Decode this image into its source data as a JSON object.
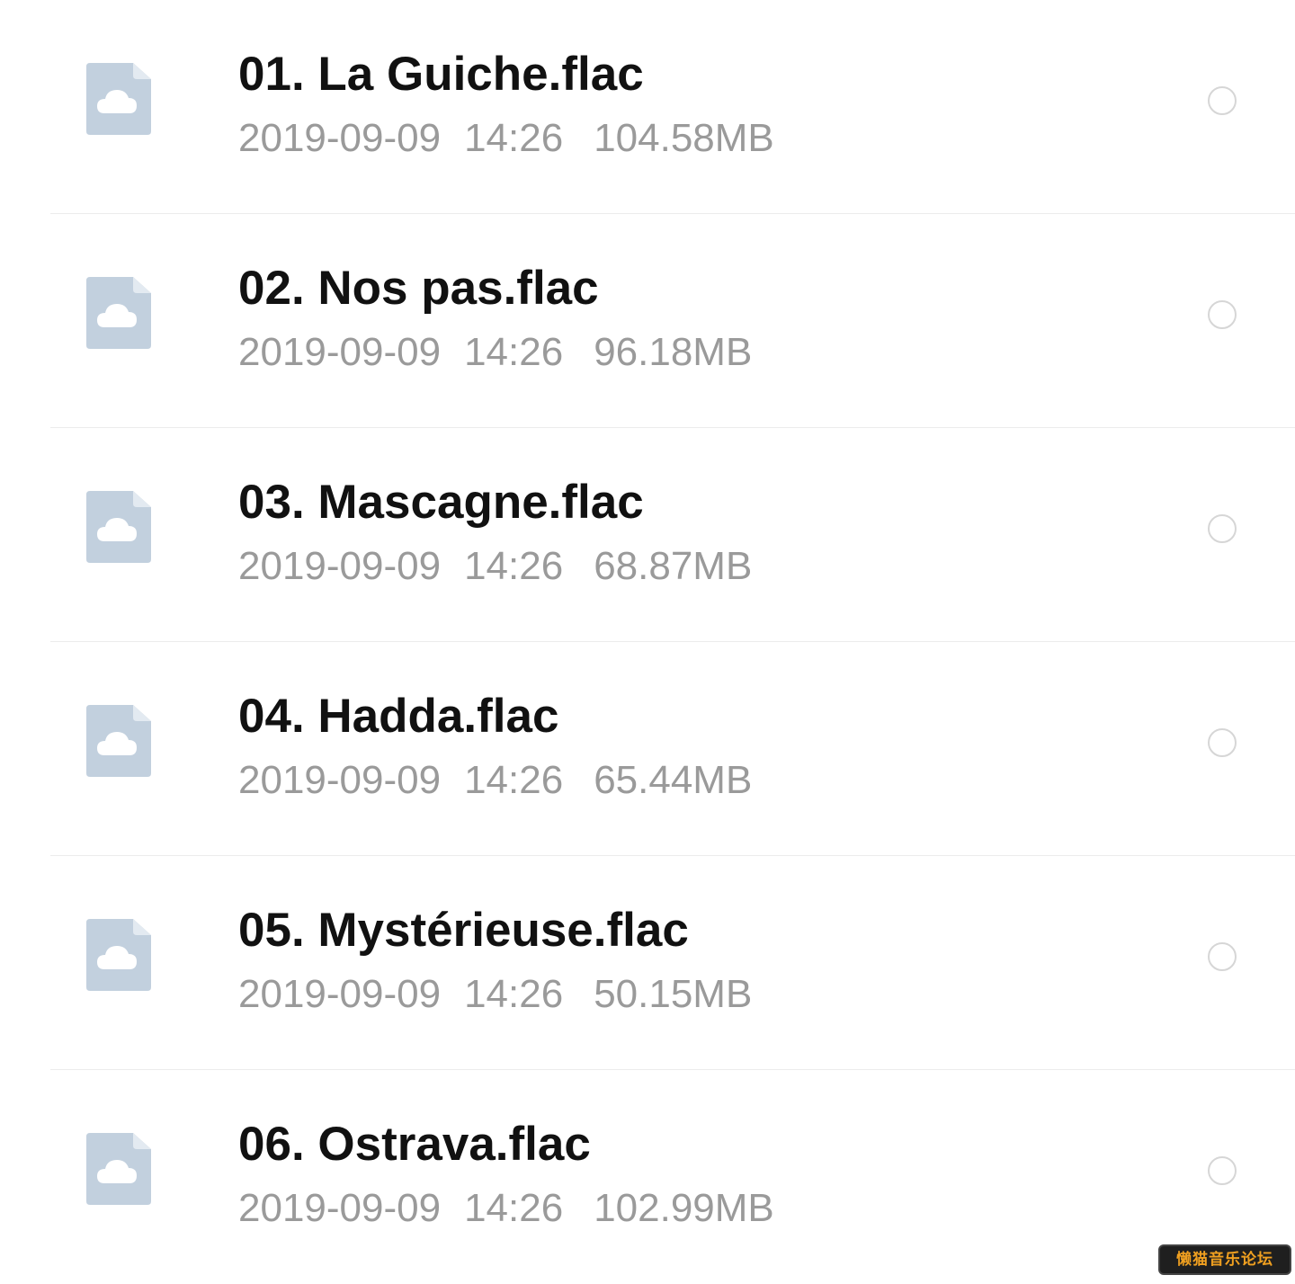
{
  "files": [
    {
      "name": "01. La Guiche.flac",
      "date": "2019-09-09",
      "time": "14:26",
      "size": "104.58MB",
      "icon": "cloud-file-icon",
      "selected": false
    },
    {
      "name": "02. Nos pas.flac",
      "date": "2019-09-09",
      "time": "14:26",
      "size": "96.18MB",
      "icon": "cloud-file-icon",
      "selected": false
    },
    {
      "name": "03. Mascagne.flac",
      "date": "2019-09-09",
      "time": "14:26",
      "size": "68.87MB",
      "icon": "cloud-file-icon",
      "selected": false
    },
    {
      "name": "04. Hadda.flac",
      "date": "2019-09-09",
      "time": "14:26",
      "size": "65.44MB",
      "icon": "cloud-file-icon",
      "selected": false
    },
    {
      "name": "05. Mystérieuse.flac",
      "date": "2019-09-09",
      "time": "14:26",
      "size": "50.15MB",
      "icon": "cloud-file-icon",
      "selected": false
    },
    {
      "name": "06. Ostrava.flac",
      "date": "2019-09-09",
      "time": "14:26",
      "size": "102.99MB",
      "icon": "cloud-file-icon",
      "selected": false
    }
  ],
  "watermark": {
    "text": "懒猫音乐论坛"
  },
  "colors": {
    "icon_fill": "#c2d0de",
    "name_text": "#111111",
    "meta_text": "#9a9a9a",
    "divider": "#ececec",
    "radio_border": "#d6d6d6",
    "watermark_text": "#f0a020",
    "watermark_bg": "#1f1f1f"
  }
}
